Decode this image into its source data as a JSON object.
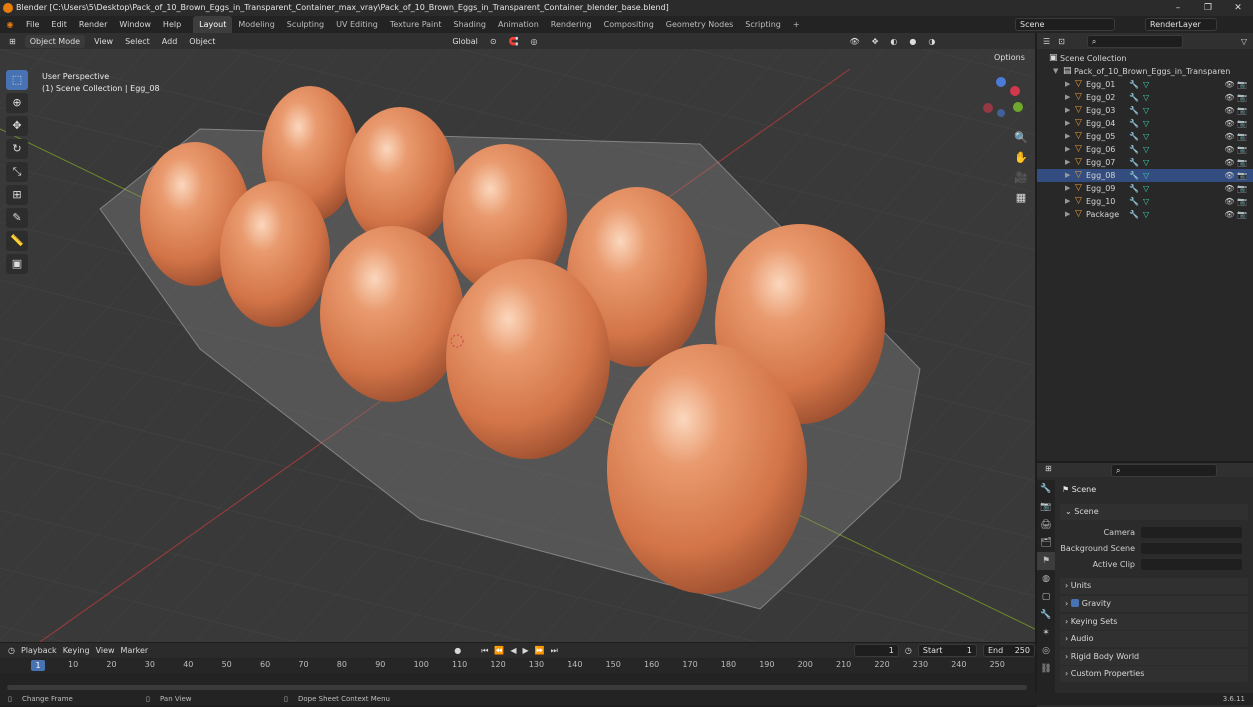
{
  "titlebar": {
    "title": "Blender [C:\\Users\\5\\Desktop\\Pack_of_10_Brown_Eggs_in_Transparent_Container_max_vray\\Pack_of_10_Brown_Eggs_in_Transparent_Container_blender_base.blend]"
  },
  "menu": [
    "File",
    "Edit",
    "Render",
    "Window",
    "Help"
  ],
  "workspaces": [
    "Layout",
    "Modeling",
    "Sculpting",
    "UV Editing",
    "Texture Paint",
    "Shading",
    "Animation",
    "Rendering",
    "Compositing",
    "Geometry Nodes",
    "Scripting"
  ],
  "workspace_add": "+",
  "scene_field": "Scene",
  "layer_field": "RenderLayer",
  "viewport_header": {
    "mode": "Object Mode",
    "view": "View",
    "select": "Select",
    "add": "Add",
    "object": "Object",
    "orientation": "Global"
  },
  "viewport_info": {
    "line1": "User Perspective",
    "line2": "(1) Scene Collection | Egg_08"
  },
  "options_label": "Options",
  "outliner": {
    "root": "Scene Collection",
    "collection": "Pack_of_10_Brown_Eggs_in_Transparen",
    "objects": [
      "Egg_01",
      "Egg_02",
      "Egg_03",
      "Egg_04",
      "Egg_05",
      "Egg_06",
      "Egg_07",
      "Egg_08",
      "Egg_09",
      "Egg_10",
      "Package"
    ],
    "selected": "Egg_08"
  },
  "properties": {
    "title": "Scene",
    "section": "Scene",
    "camera_label": "Camera",
    "bg_label": "Background Scene",
    "clip_label": "Active Clip",
    "panels": [
      "Units",
      "Gravity",
      "Keying Sets",
      "Audio",
      "Rigid Body World",
      "Custom Properties"
    ],
    "gravity_checked": true
  },
  "timeline": {
    "playback": "Playback",
    "keying": "Keying",
    "view": "View",
    "marker": "Marker",
    "current_frame": "1",
    "start_label": "Start",
    "start": "1",
    "end_label": "End",
    "end": "250",
    "ticks": [
      "10",
      "20",
      "30",
      "40",
      "50",
      "60",
      "70",
      "80",
      "90",
      "100",
      "110",
      "120",
      "130",
      "140",
      "150",
      "160",
      "170",
      "180",
      "190",
      "200",
      "210",
      "220",
      "230",
      "240",
      "250"
    ],
    "cursor": "1"
  },
  "status": {
    "left": "Change Frame",
    "mid": "Pan View",
    "right": "Dope Sheet Context Menu",
    "version": "3.6.11"
  },
  "colors": {
    "accent": "#4772b3",
    "egg": "#d9794c",
    "header": "#303030"
  }
}
